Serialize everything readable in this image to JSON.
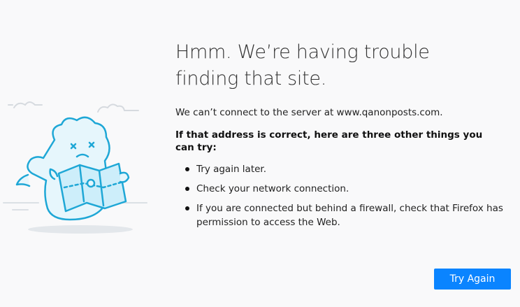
{
  "error_page": {
    "title_line1": "Hmm. We’re having trouble",
    "title_line2": "finding that site.",
    "message": "We can’t connect to the server at www.qanonposts.com.",
    "suggestions_heading": "If that address is correct, here are three other things you can try:",
    "suggestions": [
      {
        "text": "Try again later."
      },
      {
        "text": "Check your network connection."
      },
      {
        "text": "If you are connected but behind a firewall, check that Firefox has permission to access the Web."
      }
    ],
    "try_again_label": "Try Again"
  },
  "colors": {
    "background": "#f9f9fa",
    "button": "#0a84ff",
    "illustration_stroke": "#1ea7d6",
    "illustration_fill": "#e6f6fc"
  },
  "illustration": {
    "icon": "dinosaur-with-map-icon"
  }
}
